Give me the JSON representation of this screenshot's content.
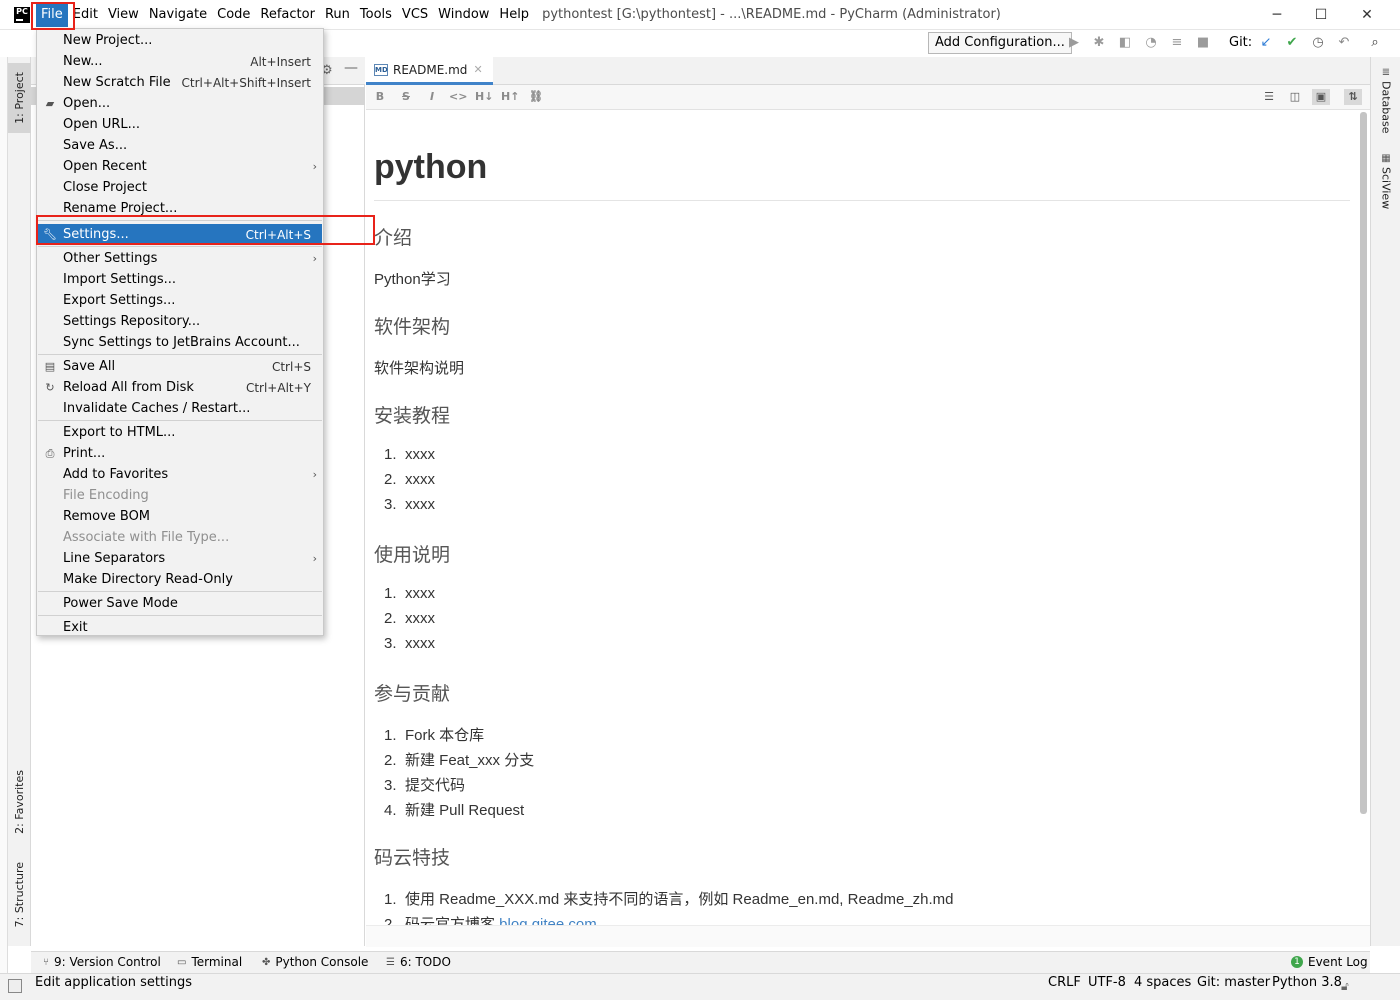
{
  "app": {
    "window_title": "pythontest [G:\\pythontest] - ...\\README.md - PyCharm (Administrator)",
    "logo_text": "PC"
  },
  "menubar": {
    "items": [
      "File",
      "Edit",
      "View",
      "Navigate",
      "Code",
      "Refactor",
      "Run",
      "Tools",
      "VCS",
      "Window",
      "Help"
    ],
    "active": "File"
  },
  "window_controls": {
    "minimize": "─",
    "maximize": "☐",
    "close": "✕"
  },
  "toolbar": {
    "add_configuration": "Add Configuration...",
    "git_label": "Git:",
    "icons": [
      "run-icon",
      "debug-icon",
      "coverage-icon",
      "profile-icon",
      "build-icon",
      "stop-icon",
      "git-update-icon",
      "git-commit-icon",
      "history-icon",
      "rollback-icon",
      "search-icon"
    ]
  },
  "left_stripe": {
    "project_tab": "1: Project",
    "favorites_tab": "2: Favorites",
    "structure_tab": "7: Structure"
  },
  "right_stripe": {
    "database_tab": "Database",
    "sciview_tab": "SciView"
  },
  "file_menu": {
    "items": [
      {
        "label": "New Project...",
        "shortcut": "",
        "icon": "",
        "disabled": false,
        "submenu": false
      },
      {
        "label": "New...",
        "shortcut": "Alt+Insert",
        "icon": "",
        "disabled": false,
        "submenu": false
      },
      {
        "label": "New Scratch File",
        "shortcut": "Ctrl+Alt+Shift+Insert",
        "icon": "",
        "disabled": false,
        "submenu": false
      },
      {
        "label": "Open...",
        "shortcut": "",
        "icon": "folder-icon",
        "disabled": false,
        "submenu": false
      },
      {
        "label": "Open URL...",
        "shortcut": "",
        "icon": "",
        "disabled": false,
        "submenu": false
      },
      {
        "label": "Save As...",
        "shortcut": "",
        "icon": "",
        "disabled": false,
        "submenu": false
      },
      {
        "label": "Open Recent",
        "shortcut": "",
        "icon": "",
        "disabled": false,
        "submenu": true
      },
      {
        "label": "Close Project",
        "shortcut": "",
        "icon": "",
        "disabled": false,
        "submenu": false
      },
      {
        "label": "Rename Project...",
        "shortcut": "",
        "icon": "",
        "disabled": false,
        "submenu": false
      },
      {
        "label": "Settings...",
        "shortcut": "Ctrl+Alt+S",
        "icon": "wrench-icon",
        "disabled": false,
        "submenu": false,
        "selected": true
      },
      {
        "label": "Other Settings",
        "shortcut": "",
        "icon": "",
        "disabled": false,
        "submenu": true
      },
      {
        "label": "Import Settings...",
        "shortcut": "",
        "icon": "",
        "disabled": false,
        "submenu": false
      },
      {
        "label": "Export Settings...",
        "shortcut": "",
        "icon": "",
        "disabled": false,
        "submenu": false
      },
      {
        "label": "Settings Repository...",
        "shortcut": "",
        "icon": "",
        "disabled": false,
        "submenu": false
      },
      {
        "label": "Sync Settings to JetBrains Account...",
        "shortcut": "",
        "icon": "",
        "disabled": false,
        "submenu": false
      },
      {
        "label": "Save All",
        "shortcut": "Ctrl+S",
        "icon": "save-icon",
        "disabled": false,
        "submenu": false
      },
      {
        "label": "Reload All from Disk",
        "shortcut": "Ctrl+Alt+Y",
        "icon": "reload-icon",
        "disabled": false,
        "submenu": false
      },
      {
        "label": "Invalidate Caches / Restart...",
        "shortcut": "",
        "icon": "",
        "disabled": false,
        "submenu": false
      },
      {
        "label": "Export to HTML...",
        "shortcut": "",
        "icon": "",
        "disabled": false,
        "submenu": false
      },
      {
        "label": "Print...",
        "shortcut": "",
        "icon": "print-icon",
        "disabled": false,
        "submenu": false
      },
      {
        "label": "Add to Favorites",
        "shortcut": "",
        "icon": "",
        "disabled": false,
        "submenu": true
      },
      {
        "label": "File Encoding",
        "shortcut": "",
        "icon": "",
        "disabled": true,
        "submenu": false
      },
      {
        "label": "Remove BOM",
        "shortcut": "",
        "icon": "",
        "disabled": false,
        "submenu": false
      },
      {
        "label": "Associate with File Type...",
        "shortcut": "",
        "icon": "",
        "disabled": true,
        "submenu": false
      },
      {
        "label": "Line Separators",
        "shortcut": "",
        "icon": "",
        "disabled": false,
        "submenu": true
      },
      {
        "label": "Make Directory Read-Only",
        "shortcut": "",
        "icon": "",
        "disabled": false,
        "submenu": false
      },
      {
        "label": "Power Save Mode",
        "shortcut": "",
        "icon": "",
        "disabled": false,
        "submenu": false
      },
      {
        "label": "Exit",
        "shortcut": "",
        "icon": "",
        "disabled": false,
        "submenu": false
      }
    ]
  },
  "editor": {
    "tab_label": "README.md",
    "tab_icon_text": "MD",
    "md_toolbar": [
      "B",
      "S",
      "I",
      "<>",
      "H↓",
      "H↑",
      "link"
    ],
    "preview": {
      "title": "python",
      "sections": [
        {
          "heading": "介绍",
          "paragraph": "Python学习"
        },
        {
          "heading": "软件架构",
          "paragraph": "软件架构说明"
        },
        {
          "heading": "安装教程",
          "list": [
            "xxxx",
            "xxxx",
            "xxxx"
          ]
        },
        {
          "heading": "使用说明",
          "list": [
            "xxxx",
            "xxxx",
            "xxxx"
          ]
        },
        {
          "heading": "参与贡献",
          "list": [
            "Fork 本仓库",
            "新建 Feat_xxx 分支",
            "提交代码",
            "新建 Pull Request"
          ]
        },
        {
          "heading": "码云特技",
          "list": [
            "使用 Readme_XXX.md 来支持不同的语言，例如 Readme_en.md, Readme_zh.md",
            "码云官方博客 "
          ],
          "link_text": "blog.gitee.com"
        }
      ]
    }
  },
  "bottom_bar": {
    "version_control": "9: Version Control",
    "terminal": "Terminal",
    "python_console": "Python Console",
    "todo": "6: TODO",
    "event_log": "Event Log",
    "event_log_count": "1"
  },
  "status_bar": {
    "message": "Edit application settings",
    "line_separator": "CRLF",
    "encoding": "UTF-8",
    "indent": "4 spaces",
    "git_branch": "Git: master",
    "interpreter": "Python 3.8"
  }
}
